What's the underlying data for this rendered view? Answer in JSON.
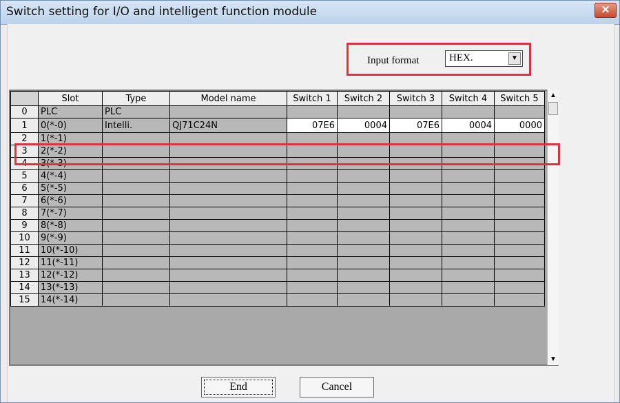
{
  "window": {
    "title": "Switch setting for I/O and intelligent function module",
    "close_label": "✕"
  },
  "input_format": {
    "label": "Input format",
    "value": "HEX.",
    "arrow": "▼"
  },
  "table": {
    "headers": [
      "",
      "Slot",
      "Type",
      "Model name",
      "Switch 1",
      "Switch 2",
      "Switch 3",
      "Switch 4",
      "Switch 5"
    ],
    "rows": [
      [
        "0",
        "PLC",
        "PLC",
        "",
        "",
        "",
        "",
        "",
        ""
      ],
      [
        "1",
        "0(*-0)",
        "Intelli.",
        "QJ71C24N",
        "07E6",
        "0004",
        "07E6",
        "0004",
        "0000"
      ],
      [
        "2",
        "1(*-1)",
        "",
        "",
        "",
        "",
        "",
        "",
        ""
      ],
      [
        "3",
        "2(*-2)",
        "",
        "",
        "",
        "",
        "",
        "",
        ""
      ],
      [
        "4",
        "3(*-3)",
        "",
        "",
        "",
        "",
        "",
        "",
        ""
      ],
      [
        "5",
        "4(*-4)",
        "",
        "",
        "",
        "",
        "",
        "",
        ""
      ],
      [
        "6",
        "5(*-5)",
        "",
        "",
        "",
        "",
        "",
        "",
        ""
      ],
      [
        "7",
        "6(*-6)",
        "",
        "",
        "",
        "",
        "",
        "",
        ""
      ],
      [
        "8",
        "7(*-7)",
        "",
        "",
        "",
        "",
        "",
        "",
        ""
      ],
      [
        "9",
        "8(*-8)",
        "",
        "",
        "",
        "",
        "",
        "",
        ""
      ],
      [
        "10",
        "9(*-9)",
        "",
        "",
        "",
        "",
        "",
        "",
        ""
      ],
      [
        "11",
        "10(*-10)",
        "",
        "",
        "",
        "",
        "",
        "",
        ""
      ],
      [
        "12",
        "11(*-11)",
        "",
        "",
        "",
        "",
        "",
        "",
        ""
      ],
      [
        "13",
        "12(*-12)",
        "",
        "",
        "",
        "",
        "",
        "",
        ""
      ],
      [
        "14",
        "13(*-13)",
        "",
        "",
        "",
        "",
        "",
        "",
        ""
      ],
      [
        "15",
        "14(*-14)",
        "",
        "",
        "",
        "",
        "",
        "",
        ""
      ]
    ]
  },
  "scrollbar": {
    "up_arrow": "▲",
    "down_arrow": "▼"
  },
  "buttons": {
    "end_label": "End",
    "cancel_label": "Cancel"
  },
  "colors": {
    "highlight": "#e0313c",
    "grid_fill": "#b8b8b8"
  }
}
